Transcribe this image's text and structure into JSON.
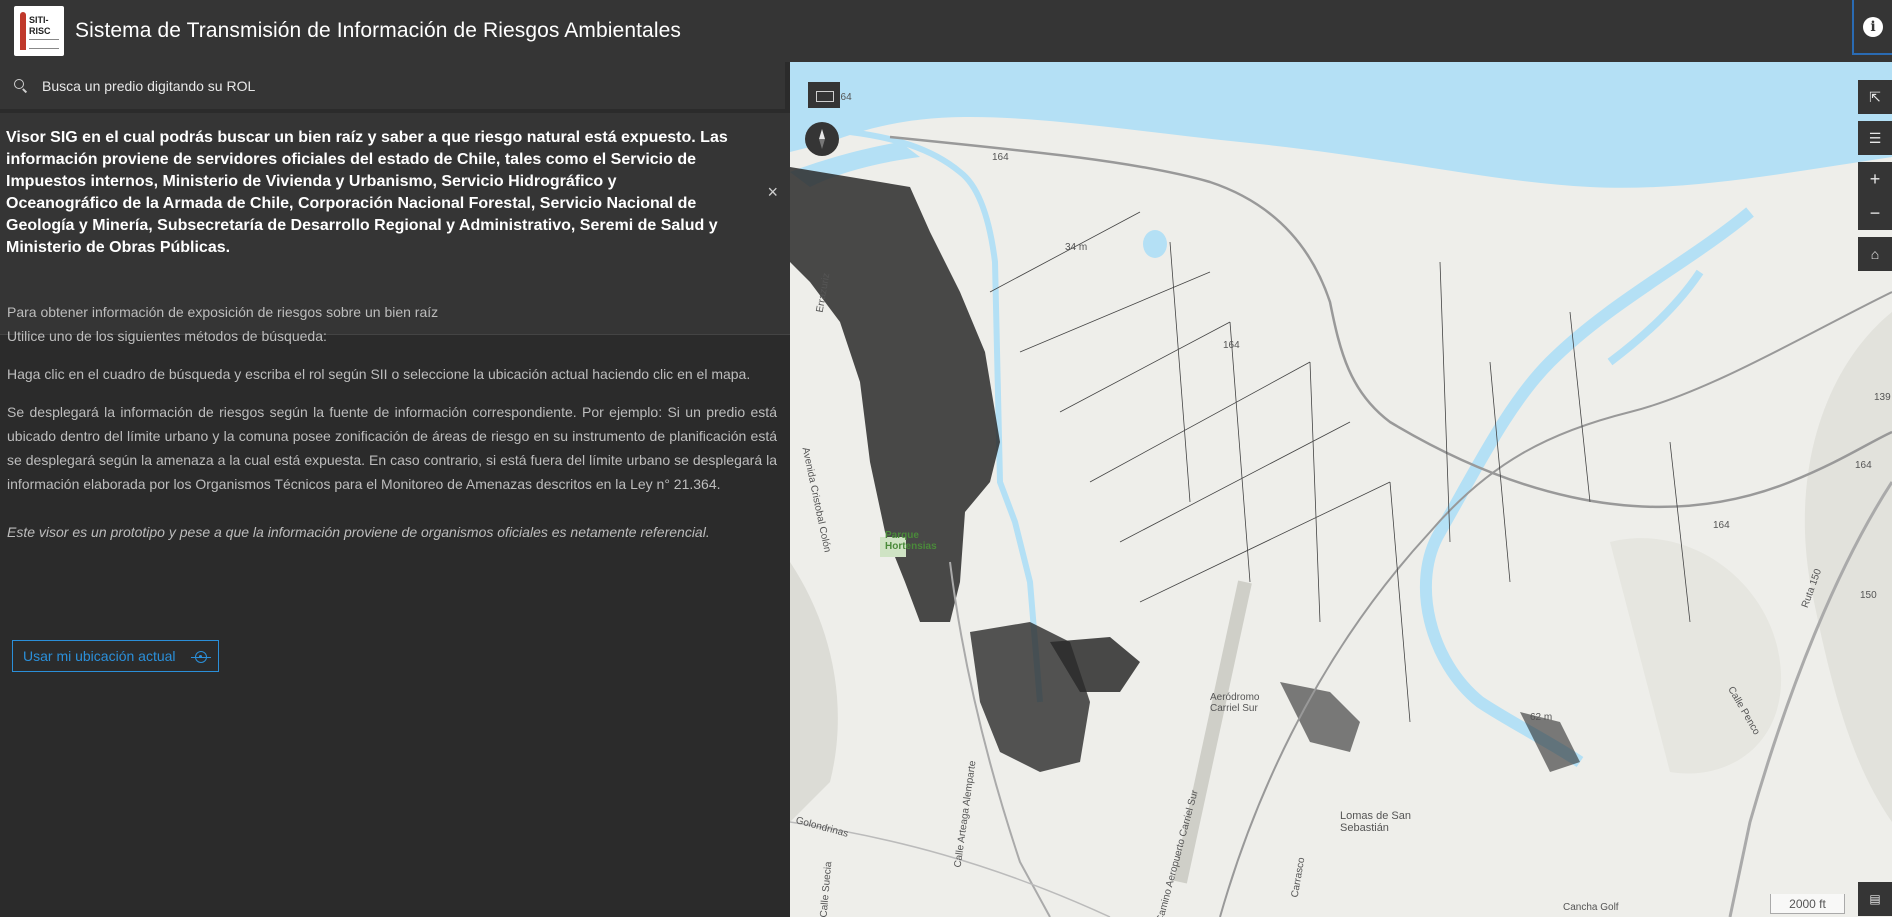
{
  "header": {
    "title": "Sistema de Transmisión de Información de Riesgos Ambientales",
    "logo_text_1": "SITI-",
    "logo_text_2": "RISC",
    "info_icon": "info-icon"
  },
  "search": {
    "placeholder": "Busca un predio digitando su ROL",
    "icon": "search-icon"
  },
  "intro": {
    "text": "Visor SIG en el cual podrás buscar un bien raíz y saber a que riesgo natural está expuesto. Las información proviene de servidores oficiales del estado de Chile, tales como el Servicio de Impuestos internos, Ministerio de Vivienda y Urbanismo, Servicio Hidrográfico y Oceanográfico de la Armada de Chile, Corporación Nacional Forestal, Servicio Nacional de Geología y Minería, Subsecretaría de Desarrollo Regional y Administrativo, Seremi de Salud y Ministerio de Obras Públicas.",
    "close_label": "×"
  },
  "body": {
    "p1a": "Para obtener información de exposición de riesgos sobre un bien raíz",
    "p1b": "Utilice uno de los siguientes métodos de búsqueda:",
    "p2": "Haga clic en el cuadro de búsqueda y escriba el rol según SII o seleccione la ubicación actual haciendo clic en el mapa.",
    "p3": "Se desplegará la información de riesgos según la fuente de información correspondiente. Por ejemplo: Si un predio está ubicado dentro del límite urbano y la comuna posee zonificación de áreas de riesgo en su instrumento de planificación está se desplegará según la amenaza a la cual está expuesta. En caso contrario, si está fuera del límite urbano se desplegará la información elaborada por los Organismos Técnicos para el Monitoreo de Amenazas descritos en la Ley n° 21.364.",
    "p4": "Este visor es un prototipo y pese a que la información proviene de organismos oficiales es netamente referencial."
  },
  "location_button": {
    "label": "Usar mi ubicación actual",
    "icon": "target-icon"
  },
  "map": {
    "labels": {
      "road_164a": "164",
      "road_164b": "164",
      "road_164c": "164",
      "road_164d": "164",
      "road_164e": "164",
      "road_150": "150",
      "road_139": "139",
      "elev_34": "34 m",
      "elev_62": "62 m",
      "parque": "Parque Hortensias",
      "aerodromo": "Aeródromo Carriel Sur",
      "lomas": "Lomas de San Sebastián",
      "cancha": "Cancha Golf",
      "av_colon": "Avenida Cristobal Colón",
      "golondrinas": "Golondrinas",
      "ruta150": "Ruta 150",
      "calle_penco": "Calle Penco",
      "carrasco": "Carrasco",
      "aeropuerto": "Camino Aeropuerto Carriel Sur",
      "arteaga": "Calle Arteaga Alemparte",
      "calle_suecia": "Calle Suecia",
      "frazuriz": "Errazuriz"
    },
    "scale": "2000 ft",
    "colors": {
      "water": "#b4e0f5",
      "land": "#eeeeea",
      "urban": "#1f1f1f"
    },
    "controls": [
      "share-icon",
      "layer-list-icon",
      "zoom-in-icon",
      "zoom-out-icon",
      "home-icon",
      "legend-icon"
    ]
  }
}
